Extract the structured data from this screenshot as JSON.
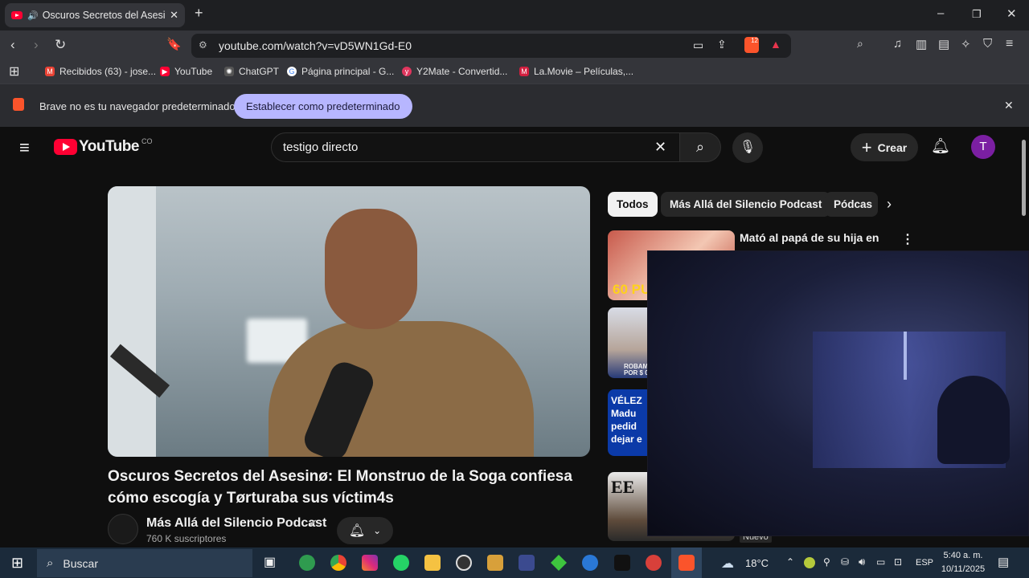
{
  "browser": {
    "tab_title": "Oscuros Secretos del Asesinø",
    "url": "youtube.com/watch?v=vD5WN1Gd-E0",
    "brave_badge": "12"
  },
  "bookmarks": [
    {
      "label": "Recibidos (63) - jose...",
      "icon": "gmail-icon",
      "color": "#ea4335"
    },
    {
      "label": "YouTube",
      "icon": "youtube-icon",
      "color": "#ff0033"
    },
    {
      "label": "ChatGPT",
      "icon": "chatgpt-icon",
      "color": "#cfcfcf"
    },
    {
      "label": "Página principal - G...",
      "icon": "google-icon",
      "color": "#4285f4"
    },
    {
      "label": "Y2Mate - Convertid...",
      "icon": "y2mate-icon",
      "color": "#e0355d"
    },
    {
      "label": "La.Movie – Películas,...",
      "icon": "lamovie-icon",
      "color": "#d11f3f"
    }
  ],
  "infobar": {
    "message": "Brave no es tu navegador predeterminado",
    "button": "Establecer como predeterminado"
  },
  "youtube": {
    "logo": "YouTube",
    "region": "CO",
    "search_value": "testigo directo",
    "create_label": "Crear",
    "avatar_letter": "T",
    "video_title": "Oscuros Secretos del Asesinø: El Monstruo de la Soga confiesa cómo escogía y Tørturaba sus víctim4s",
    "channel_name": "Más Allá del Silencio Podcast",
    "subscribers": "760 K suscriptores",
    "chips": [
      "Todos",
      "Más Allá del Silencio Podcast",
      "Pódcas"
    ],
    "recommended": [
      {
        "title": "Mató al papá de su hija en",
        "thumb_text": "60 PU"
      },
      {
        "title": "",
        "thumb_text": "ROBAMO POR $ 0"
      },
      {
        "title": "",
        "thumb_text": "VÉLEZ Madu pedid dejar e"
      },
      {
        "title": "",
        "thumb_text": "EE"
      }
    ],
    "new_badge": "Nuevo"
  },
  "taskbar": {
    "search_placeholder": "Buscar",
    "weather": "18°C",
    "language": "ESP",
    "time": "5:40 a. m.",
    "date": "10/11/2025"
  },
  "colors": {
    "accent_red": "#ff0033",
    "brave_button": "#b7b6ff",
    "avatar": "#7b1fa2"
  }
}
